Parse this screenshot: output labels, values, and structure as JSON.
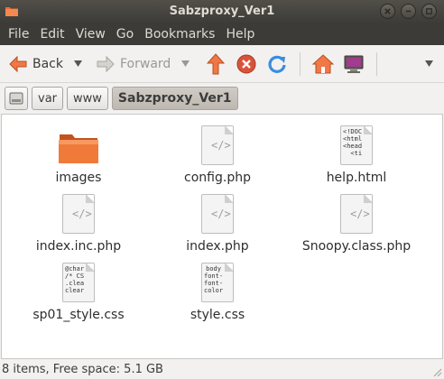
{
  "window": {
    "title": "Sabzproxy_Ver1"
  },
  "menu": [
    "File",
    "Edit",
    "View",
    "Go",
    "Bookmarks",
    "Help"
  ],
  "toolbar": {
    "back_label": "Back",
    "forward_label": "Forward",
    "icons": [
      "back-arrow-icon",
      "forward-arrow-icon",
      "up-arrow-icon",
      "stop-icon",
      "reload-icon",
      "home-icon",
      "computer-icon"
    ]
  },
  "path": [
    "var",
    "www",
    "Sabzproxy_Ver1"
  ],
  "files": [
    {
      "name": "images",
      "type": "folder"
    },
    {
      "name": "config.php",
      "type": "php"
    },
    {
      "name": "help.html",
      "type": "html",
      "preview": "<!DOC\n<html\n<head\n  <ti"
    },
    {
      "name": "index.inc.php",
      "type": "php"
    },
    {
      "name": "index.php",
      "type": "php"
    },
    {
      "name": "Snoopy.class.php",
      "type": "php"
    },
    {
      "name": "sp01_style.css",
      "type": "css",
      "preview": "@char\n/* CS\n.clea\nclear"
    },
    {
      "name": "style.css",
      "type": "css",
      "preview": "body\nfont-\nfont-\ncolor"
    }
  ],
  "status": {
    "text": "8 items, Free space: 5.1 GB"
  },
  "colors": {
    "titlebar": "#3c3b37",
    "accent": "#f07746",
    "folder": "#e96a2c"
  }
}
